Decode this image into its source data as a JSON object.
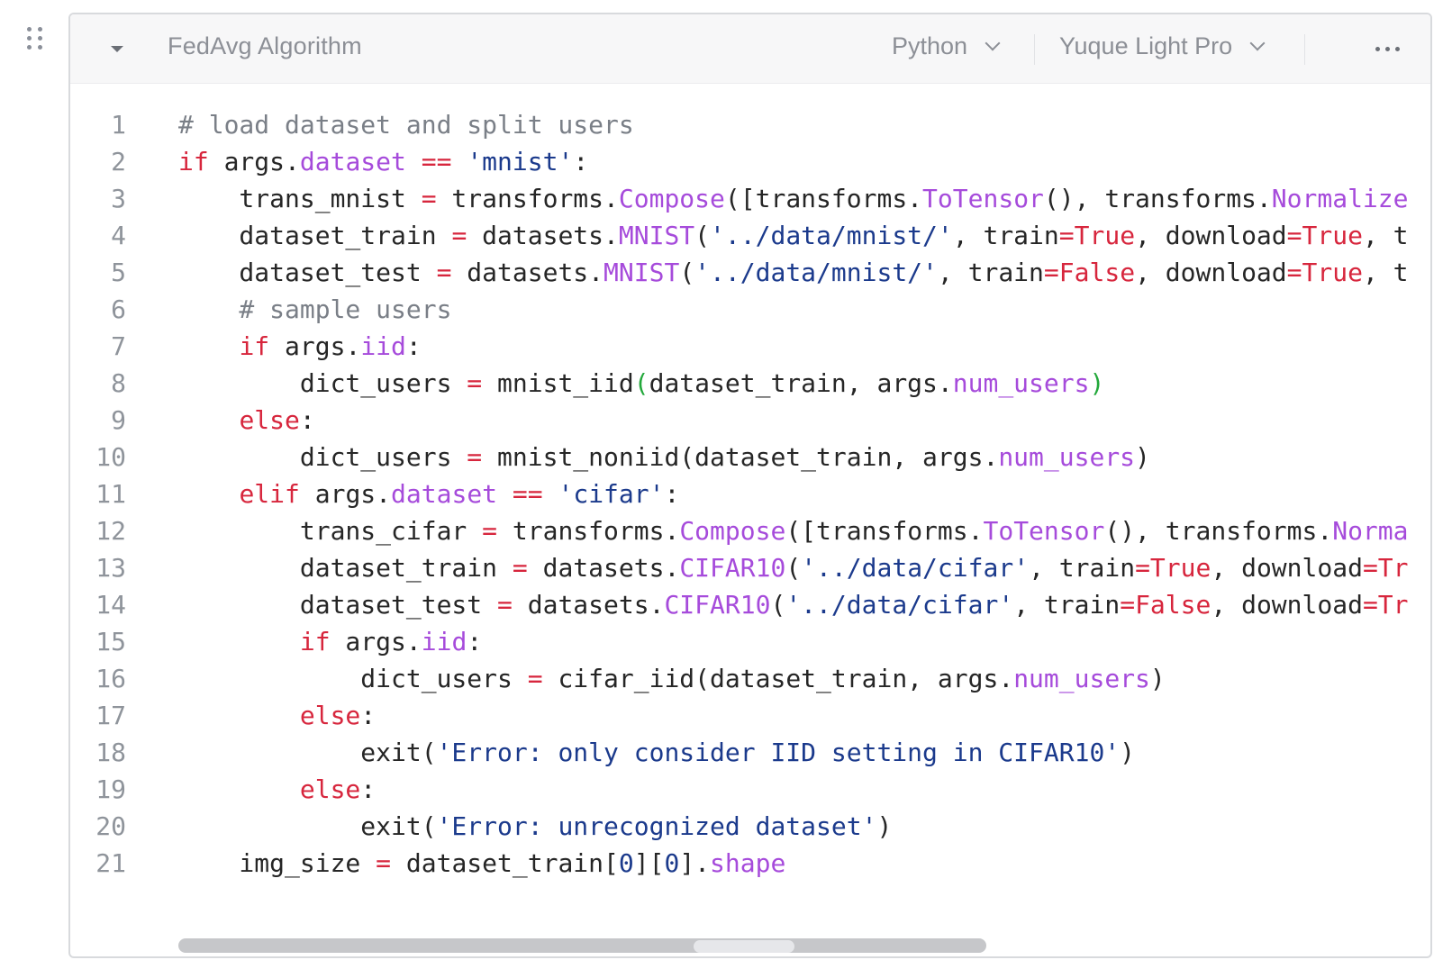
{
  "block": {
    "title": "FedAvg Algorithm",
    "language": "Python",
    "theme": "Yuque Light Pro",
    "more_label": "···"
  },
  "colors": {
    "keyword": "#d7263d",
    "property": "#a64bdb",
    "string": "#1b3a8c",
    "comment": "#7a7f87",
    "number": "#1b3a8c",
    "bracket_match": "#22a83a",
    "plain": "#262626",
    "line_number": "#8f949b"
  },
  "code_lines": [
    {
      "n": "1",
      "tokens": [
        [
          "c",
          "# load dataset and split users"
        ]
      ]
    },
    {
      "n": "2",
      "tokens": [
        [
          "k",
          "if"
        ],
        [
          "p",
          " args."
        ],
        [
          "a",
          "dataset"
        ],
        [
          "p",
          " "
        ],
        [
          "k",
          "=="
        ],
        [
          "p",
          " "
        ],
        [
          "s",
          "'mnist'"
        ],
        [
          "p",
          ":"
        ]
      ]
    },
    {
      "n": "3",
      "tokens": [
        [
          "p",
          "    trans_mnist "
        ],
        [
          "k",
          "="
        ],
        [
          "p",
          " transforms."
        ],
        [
          "a",
          "Compose"
        ],
        [
          "p",
          "([transforms."
        ],
        [
          "a",
          "ToTensor"
        ],
        [
          "p",
          "(), transforms."
        ],
        [
          "a",
          "Normalize"
        ]
      ]
    },
    {
      "n": "4",
      "tokens": [
        [
          "p",
          "    dataset_train "
        ],
        [
          "k",
          "="
        ],
        [
          "p",
          " datasets."
        ],
        [
          "a",
          "MNIST"
        ],
        [
          "p",
          "("
        ],
        [
          "s",
          "'../data/mnist/'"
        ],
        [
          "p",
          ", train"
        ],
        [
          "k",
          "=True"
        ],
        [
          "p",
          ", download"
        ],
        [
          "k",
          "=True"
        ],
        [
          "p",
          ", t"
        ]
      ]
    },
    {
      "n": "5",
      "tokens": [
        [
          "p",
          "    dataset_test "
        ],
        [
          "k",
          "="
        ],
        [
          "p",
          " datasets."
        ],
        [
          "a",
          "MNIST"
        ],
        [
          "p",
          "("
        ],
        [
          "s",
          "'../data/mnist/'"
        ],
        [
          "p",
          ", train"
        ],
        [
          "k",
          "=False"
        ],
        [
          "p",
          ", download"
        ],
        [
          "k",
          "=True"
        ],
        [
          "p",
          ", t"
        ]
      ]
    },
    {
      "n": "6",
      "tokens": [
        [
          "c",
          "    # sample users"
        ]
      ]
    },
    {
      "n": "7",
      "tokens": [
        [
          "p",
          "    "
        ],
        [
          "k",
          "if"
        ],
        [
          "p",
          " args."
        ],
        [
          "a",
          "iid"
        ],
        [
          "p",
          ":"
        ]
      ]
    },
    {
      "n": "8",
      "tokens": [
        [
          "p",
          "        dict_users "
        ],
        [
          "k",
          "="
        ],
        [
          "p",
          " mnist_iid"
        ],
        [
          "g",
          "("
        ],
        [
          "p",
          "dataset_train, args."
        ],
        [
          "a",
          "num_users"
        ],
        [
          "g",
          ")"
        ]
      ]
    },
    {
      "n": "9",
      "tokens": [
        [
          "p",
          "    "
        ],
        [
          "k",
          "else"
        ],
        [
          "p",
          ":"
        ]
      ]
    },
    {
      "n": "10",
      "tokens": [
        [
          "p",
          "        dict_users "
        ],
        [
          "k",
          "="
        ],
        [
          "p",
          " mnist_noniid(dataset_train, args."
        ],
        [
          "a",
          "num_users"
        ],
        [
          "p",
          ")"
        ]
      ]
    },
    {
      "n": "11",
      "tokens": [
        [
          "p",
          "    "
        ],
        [
          "k",
          "elif"
        ],
        [
          "p",
          " args."
        ],
        [
          "a",
          "dataset"
        ],
        [
          "p",
          " "
        ],
        [
          "k",
          "=="
        ],
        [
          "p",
          " "
        ],
        [
          "s",
          "'cifar'"
        ],
        [
          "p",
          ":"
        ]
      ]
    },
    {
      "n": "12",
      "tokens": [
        [
          "p",
          "        trans_cifar "
        ],
        [
          "k",
          "="
        ],
        [
          "p",
          " transforms."
        ],
        [
          "a",
          "Compose"
        ],
        [
          "p",
          "([transforms."
        ],
        [
          "a",
          "ToTensor"
        ],
        [
          "p",
          "(), transforms."
        ],
        [
          "a",
          "Norma"
        ]
      ]
    },
    {
      "n": "13",
      "tokens": [
        [
          "p",
          "        dataset_train "
        ],
        [
          "k",
          "="
        ],
        [
          "p",
          " datasets."
        ],
        [
          "a",
          "CIFAR10"
        ],
        [
          "p",
          "("
        ],
        [
          "s",
          "'../data/cifar'"
        ],
        [
          "p",
          ", train"
        ],
        [
          "k",
          "=True"
        ],
        [
          "p",
          ", download"
        ],
        [
          "k",
          "=Tr"
        ]
      ]
    },
    {
      "n": "14",
      "tokens": [
        [
          "p",
          "        dataset_test "
        ],
        [
          "k",
          "="
        ],
        [
          "p",
          " datasets."
        ],
        [
          "a",
          "CIFAR10"
        ],
        [
          "p",
          "("
        ],
        [
          "s",
          "'../data/cifar'"
        ],
        [
          "p",
          ", train"
        ],
        [
          "k",
          "=False"
        ],
        [
          "p",
          ", download"
        ],
        [
          "k",
          "=Tr"
        ]
      ]
    },
    {
      "n": "15",
      "tokens": [
        [
          "p",
          "        "
        ],
        [
          "k",
          "if"
        ],
        [
          "p",
          " args."
        ],
        [
          "a",
          "iid"
        ],
        [
          "p",
          ":"
        ]
      ]
    },
    {
      "n": "16",
      "tokens": [
        [
          "p",
          "            dict_users "
        ],
        [
          "k",
          "="
        ],
        [
          "p",
          " cifar_iid(dataset_train, args."
        ],
        [
          "a",
          "num_users"
        ],
        [
          "p",
          ")"
        ]
      ]
    },
    {
      "n": "17",
      "tokens": [
        [
          "p",
          "        "
        ],
        [
          "k",
          "else"
        ],
        [
          "p",
          ":"
        ]
      ]
    },
    {
      "n": "18",
      "tokens": [
        [
          "p",
          "            exit("
        ],
        [
          "s",
          "'Error: only consider IID setting in CIFAR10'"
        ],
        [
          "p",
          ")"
        ]
      ]
    },
    {
      "n": "19",
      "tokens": [
        [
          "p",
          "        "
        ],
        [
          "k",
          "else"
        ],
        [
          "p",
          ":"
        ]
      ]
    },
    {
      "n": "20",
      "tokens": [
        [
          "p",
          "            exit("
        ],
        [
          "s",
          "'Error: unrecognized dataset'"
        ],
        [
          "p",
          ")"
        ]
      ]
    },
    {
      "n": "21",
      "tokens": [
        [
          "p",
          "    img_size "
        ],
        [
          "k",
          "="
        ],
        [
          "p",
          " dataset_train["
        ],
        [
          "s",
          "0"
        ],
        [
          "p",
          "]["
        ],
        [
          "s",
          "0"
        ],
        [
          "p",
          "]."
        ],
        [
          "a",
          "shape"
        ]
      ]
    }
  ],
  "scroll": {
    "horizontal_position": 0,
    "horizontal_visible_fraction": 0.65
  }
}
